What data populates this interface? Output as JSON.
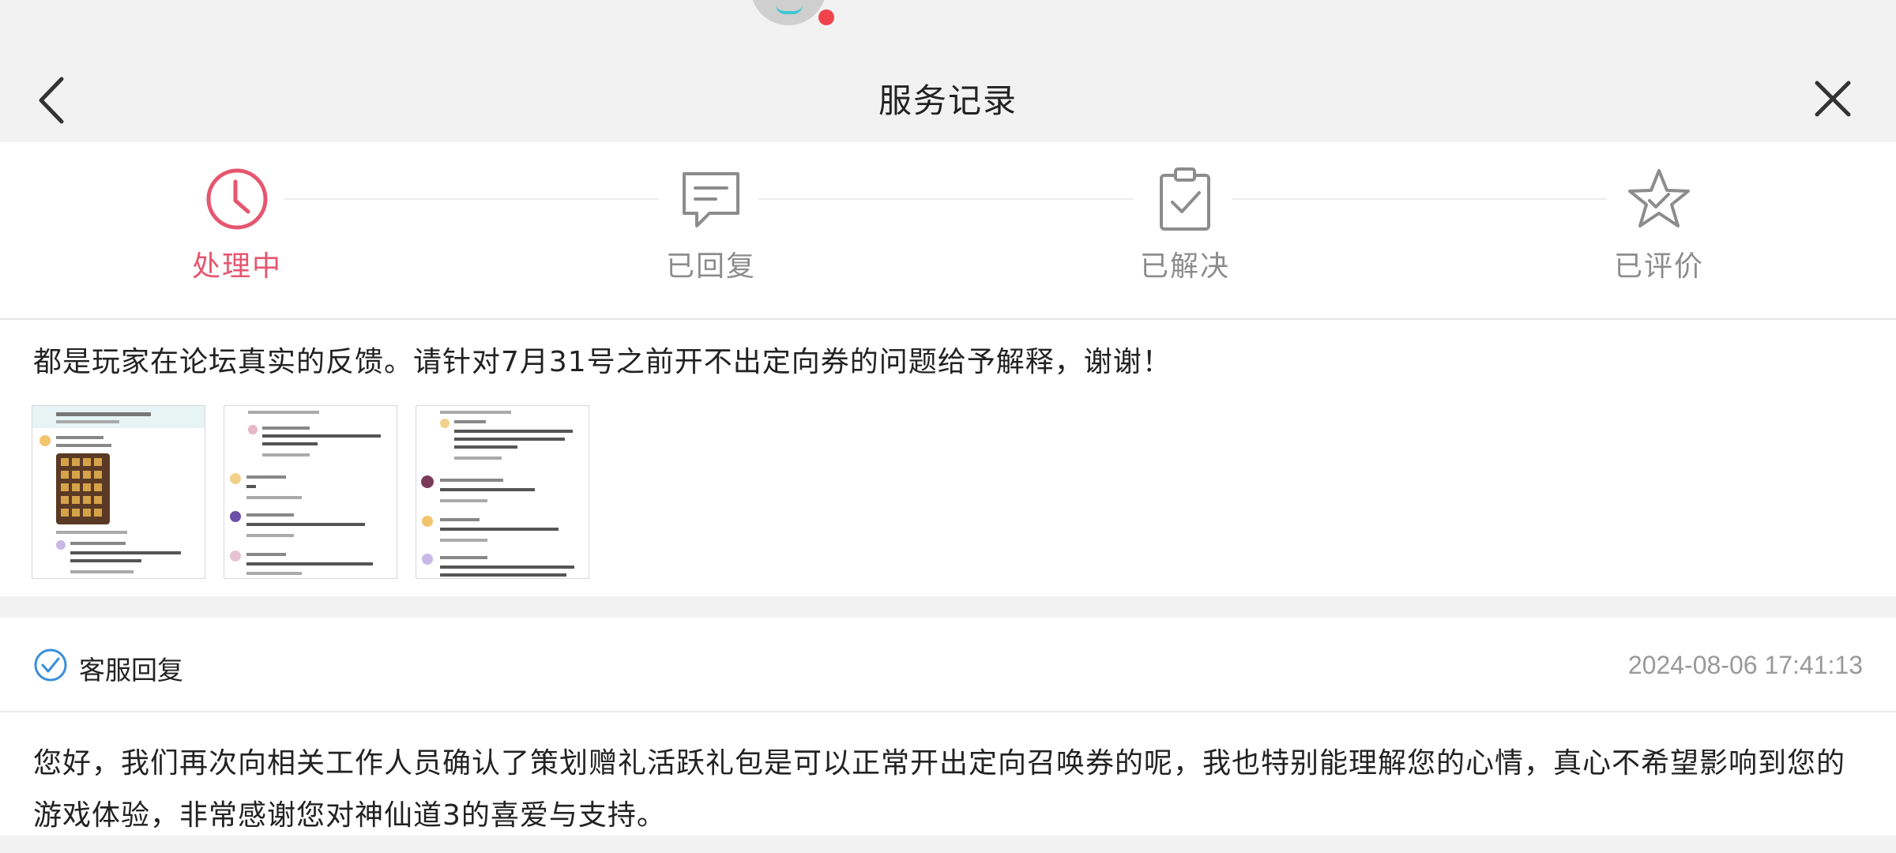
{
  "header": {
    "title": "服务记录",
    "back_icon": "chevron-left-icon",
    "close_icon": "close-icon"
  },
  "steps": [
    {
      "label": "处理中",
      "icon": "clock-icon",
      "active": true
    },
    {
      "label": "已回复",
      "icon": "message-icon",
      "active": false
    },
    {
      "label": "已解决",
      "icon": "clipboard-check-icon",
      "active": false
    },
    {
      "label": "已评价",
      "icon": "star-icon",
      "active": false
    }
  ],
  "ticket": {
    "question": "都是玩家在论坛真实的反馈。请针对7月31号之前开不出定向券的问题给予解释，谢谢！",
    "attachments": [
      "forum-screenshot-1",
      "forum-screenshot-2",
      "forum-screenshot-3"
    ]
  },
  "reply": {
    "label": "客服回复",
    "timestamp": "2024-08-06 17:41:13",
    "body": "您好，我们再次向相关工作人员确认了策划赠礼活跃礼包是可以正常开出定向召唤券的呢，我也特别能理解您的心情，真心不希望影响到您的游戏体验，非常感谢您对神仙道3的喜爱与支持。"
  },
  "colors": {
    "accent": "#e5566f",
    "inactive": "#8c8c8c",
    "reply_icon": "#3a8fd9",
    "background": "#f2f2f2"
  }
}
